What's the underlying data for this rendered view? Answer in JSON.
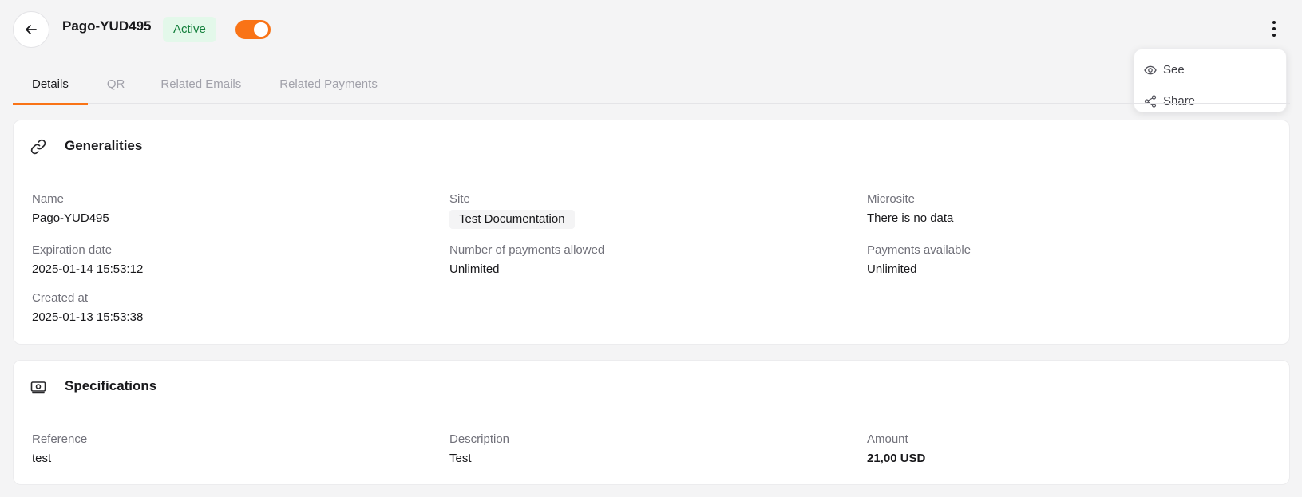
{
  "header": {
    "title": "Pago-YUD495",
    "status": "Active",
    "toggle_on": true,
    "accent": "#f97316"
  },
  "menu": {
    "items": [
      {
        "label": "See",
        "icon": "eye-icon"
      },
      {
        "label": "Share",
        "icon": "share-icon"
      }
    ]
  },
  "tabs": [
    {
      "label": "Details",
      "active": true
    },
    {
      "label": "QR",
      "active": false
    },
    {
      "label": "Related Emails",
      "active": false
    },
    {
      "label": "Related Payments",
      "active": false
    }
  ],
  "generalities": {
    "title": "Generalities",
    "icon": "link-icon",
    "name_label": "Name",
    "name_value": "Pago-YUD495",
    "site_label": "Site",
    "site_value": "Test Documentation",
    "microsite_label": "Microsite",
    "microsite_value": "There is no data",
    "expiration_label": "Expiration date",
    "expiration_value": "2025-01-14 15:53:12",
    "payments_allowed_label": "Number of payments allowed",
    "payments_allowed_value": "Unlimited",
    "payments_available_label": "Payments available",
    "payments_available_value": "Unlimited",
    "created_label": "Created at",
    "created_value": "2025-01-13 15:53:38"
  },
  "specifications": {
    "title": "Specifications",
    "icon": "money-icon",
    "reference_label": "Reference",
    "reference_value": "test",
    "description_label": "Description",
    "description_value": "Test",
    "amount_label": "Amount",
    "amount_value": "21,00 USD"
  }
}
